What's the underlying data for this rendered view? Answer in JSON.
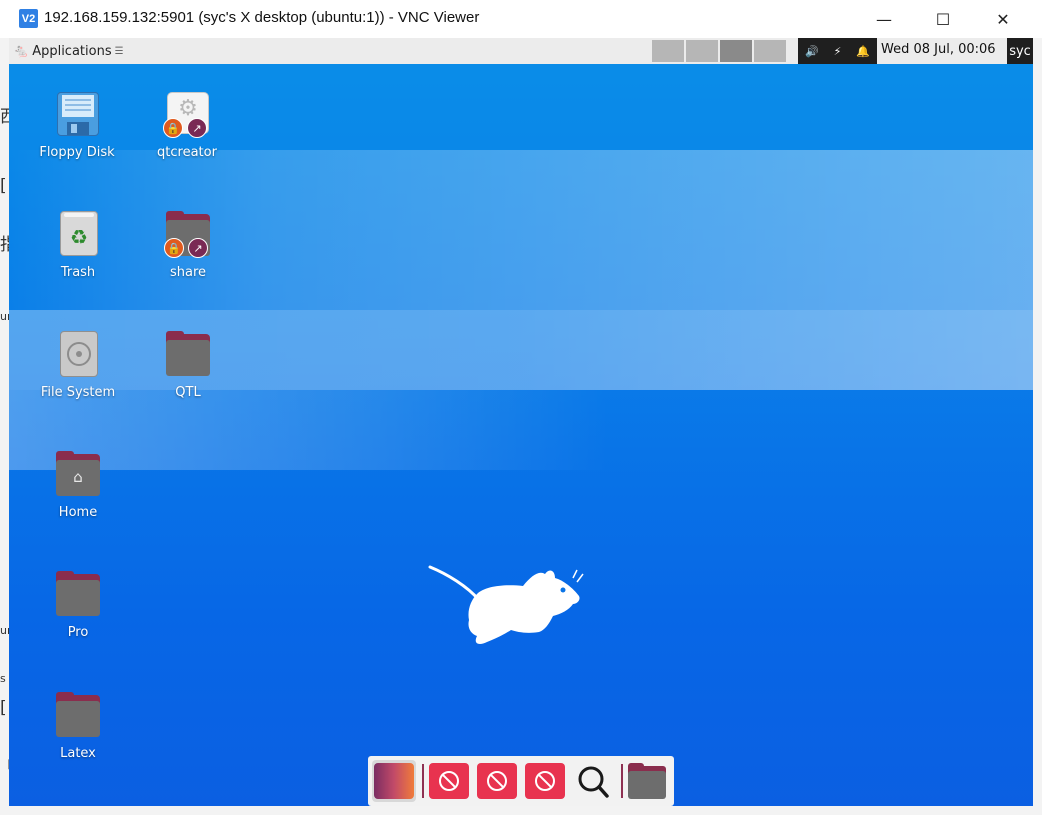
{
  "host": {
    "side_glyphs": [
      "西",
      "[",
      "指",
      "ur",
      "ur",
      "s",
      "[",
      "刂"
    ]
  },
  "window": {
    "logo": "V2",
    "title": "192.168.159.132:5901 (syc's X desktop (ubuntu:1)) - VNC Viewer",
    "minimize_glyph": "—",
    "maximize_glyph": "☐",
    "close_glyph": "✕"
  },
  "panel": {
    "applications_label": "Applications",
    "applications_suffix": "☰",
    "workspaces": [
      "1",
      "2",
      "3",
      "4"
    ],
    "active_workspace": 3,
    "tray_icons": [
      "volume-icon",
      "power-icon",
      "bell-icon"
    ],
    "volume_glyph": "🔊",
    "power_glyph": "⚡",
    "bell_glyph": "🔔",
    "clock": "Wed 08 Jul, 00:06",
    "user": "syc"
  },
  "desktop": {
    "icons": [
      {
        "label": "Floppy Disk",
        "icon": "floppy-disk-icon"
      },
      {
        "label": "qtcreator",
        "icon": "qtcreator-icon"
      },
      {
        "label": "Trash",
        "icon": "trash-icon"
      },
      {
        "label": "share",
        "icon": "folder-icon"
      },
      {
        "label": "File System",
        "icon": "hard-drive-icon"
      },
      {
        "label": "QTL",
        "icon": "folder-icon"
      },
      {
        "label": "Home",
        "icon": "home-folder-icon"
      },
      {
        "label": "Pro",
        "icon": "folder-icon"
      },
      {
        "label": "Latex",
        "icon": "folder-icon"
      }
    ],
    "colors": {
      "folder_back": "#8a2d4d",
      "folder_front": "#6d6d6d",
      "lock_badge": "#e05a1e",
      "link_badge": "#7a2a55"
    }
  },
  "dock": {
    "items": [
      "show-desktop-icon",
      "blocked-launcher-icon",
      "blocked-launcher-icon",
      "blocked-launcher-icon",
      "search-icon",
      "folder-icon"
    ],
    "accent": "#e8334f"
  }
}
